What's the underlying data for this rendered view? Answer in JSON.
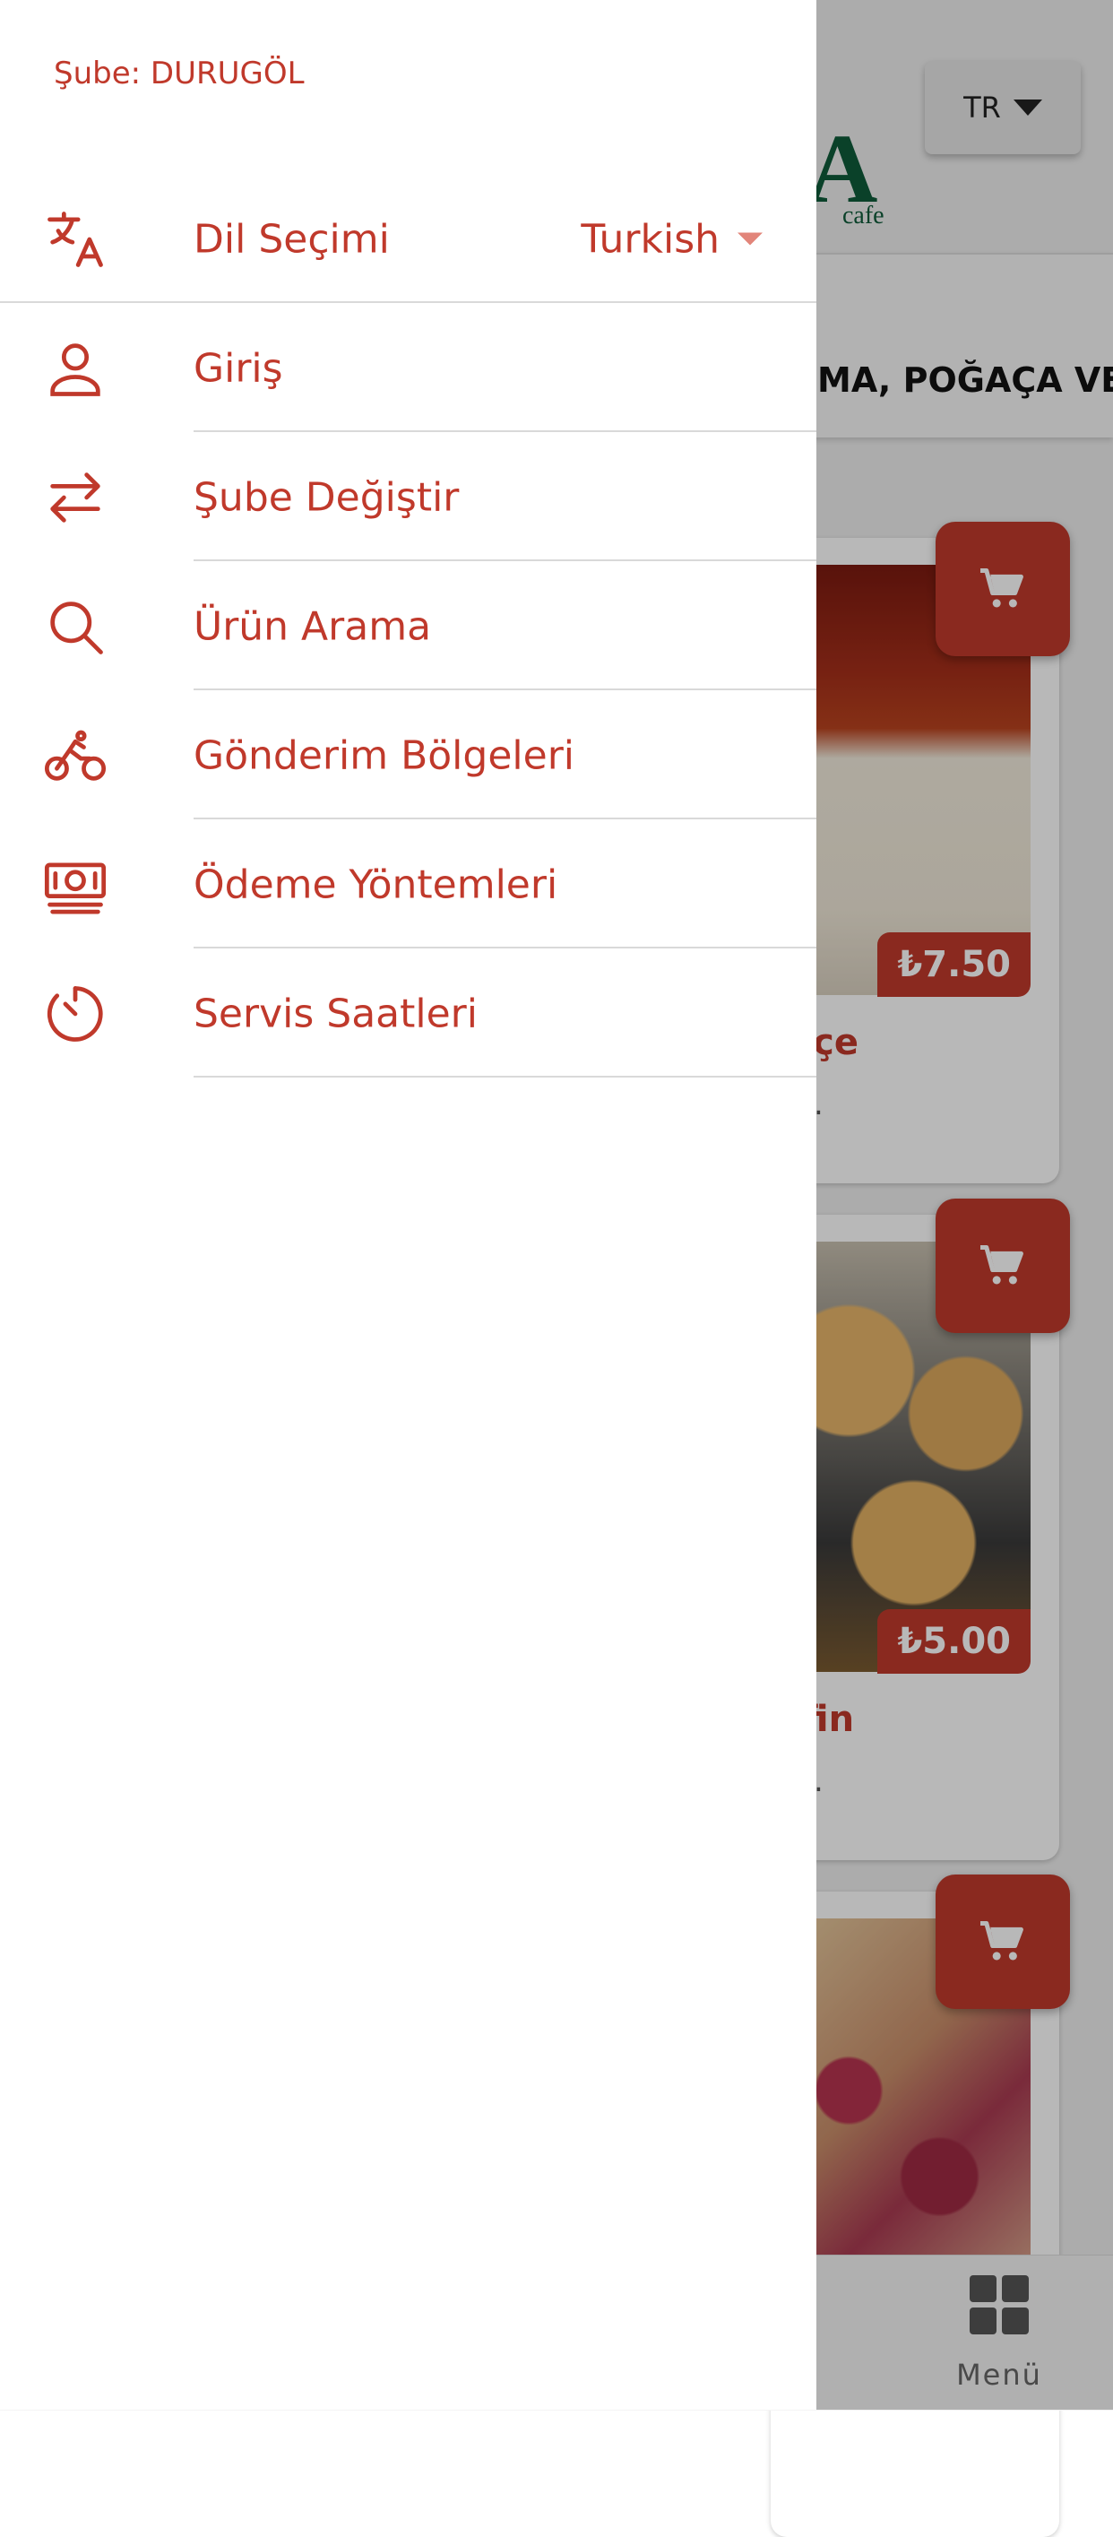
{
  "colors": {
    "accent": "#c0392b",
    "overlay": "rgba(0,0,0,0.28)",
    "logo": "#0f5a3a"
  },
  "drawer": {
    "branch": "Şube: DURUGÖL",
    "language": {
      "label": "Dil Seçimi",
      "value": "Turkish",
      "icon": "translate-icon"
    },
    "items": [
      {
        "label": "Giriş",
        "icon": "user-icon"
      },
      {
        "label": "Şube Değiştir",
        "icon": "swap-icon"
      },
      {
        "label": "Ürün Arama",
        "icon": "search-icon"
      },
      {
        "label": "Gönderim Bölgeleri",
        "icon": "bicycle-icon"
      },
      {
        "label": "Ödeme Yöntemleri",
        "icon": "money-icon"
      },
      {
        "label": "Servis Saatleri",
        "icon": "timer-icon"
      }
    ]
  },
  "background": {
    "lang_button": "TR",
    "logo_letter": "A",
    "logo_sub": "cafe",
    "category_bar": "MA, POĞAÇA VE",
    "products": [
      {
        "name": "eçe",
        "price": "₺7.50",
        "desc": "."
      },
      {
        "name": "ffin",
        "price": "₺5.00",
        "desc": "."
      },
      {
        "name": "",
        "price": "",
        "desc": ""
      }
    ],
    "bottom_nav": {
      "menu_label": "Menü",
      "icon": "grid-icon"
    }
  }
}
